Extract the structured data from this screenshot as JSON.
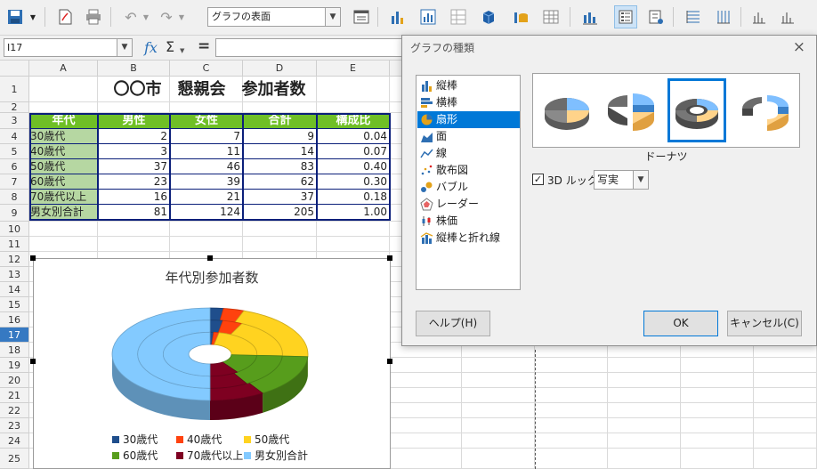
{
  "toolbar": {
    "fill_select": "グラフの表面"
  },
  "formula_bar": {
    "cell_ref": "I17",
    "fx": "fx",
    "sum": "Σ",
    "equals": "="
  },
  "sheet": {
    "columns": [
      "A",
      "B",
      "C",
      "D",
      "E"
    ],
    "rows": [
      "1",
      "2",
      "3",
      "4",
      "5",
      "6",
      "7",
      "8",
      "9",
      "10",
      "11",
      "12",
      "13",
      "14",
      "15",
      "16",
      "17",
      "18",
      "19",
      "20",
      "21",
      "22",
      "23",
      "24",
      "25"
    ],
    "selected_row": "17",
    "title": "〇〇市　懇親会　参加者数",
    "headers": [
      "年代",
      "男性",
      "女性",
      "合計",
      "構成比"
    ],
    "data": [
      [
        "30歳代",
        "2",
        "7",
        "9",
        "0.04"
      ],
      [
        "40歳代",
        "3",
        "11",
        "14",
        "0.07"
      ],
      [
        "50歳代",
        "37",
        "46",
        "83",
        "0.40"
      ],
      [
        "60歳代",
        "23",
        "39",
        "62",
        "0.30"
      ],
      [
        "70歳代以上",
        "16",
        "21",
        "37",
        "0.18"
      ],
      [
        "男女別合計",
        "81",
        "124",
        "205",
        "1.00"
      ]
    ]
  },
  "chart_data": {
    "type": "pie",
    "subtype": "3D donut",
    "title": "年代別参加者数",
    "series": [
      {
        "name": "30歳代",
        "color": "#1f4e8c"
      },
      {
        "name": "40歳代",
        "color": "#ff420e"
      },
      {
        "name": "50歳代",
        "color": "#ffd320"
      },
      {
        "name": "60歳代",
        "color": "#579d1c"
      },
      {
        "name": "70歳代以上",
        "color": "#7e0021"
      },
      {
        "name": "男女別合計",
        "color": "#83caff"
      }
    ],
    "categories": [
      "男性",
      "女性",
      "合計"
    ],
    "values": [
      [
        2,
        7,
        9
      ],
      [
        3,
        11,
        14
      ],
      [
        37,
        46,
        83
      ],
      [
        23,
        39,
        62
      ],
      [
        16,
        21,
        37
      ],
      [
        81,
        124,
        205
      ]
    ],
    "legend_position": "bottom"
  },
  "dialog": {
    "title": "グラフの種類",
    "close": "×",
    "types": [
      "縦棒",
      "横棒",
      "扇形",
      "面",
      "線",
      "散布図",
      "バブル",
      "レーダー",
      "株価",
      "縦棒と折れ線"
    ],
    "selected_type": "扇形",
    "subtype_label": "ドーナツ",
    "look_3d_label": "3D ルック",
    "look_3d_checked": true,
    "look_select": "写実",
    "help": "ヘルプ(H)",
    "ok": "OK",
    "cancel": "キャンセル(C)"
  },
  "colors": {
    "header_green": "#6fbf26",
    "label_green": "#b6d7a2",
    "selection_blue": "#0078d7"
  }
}
